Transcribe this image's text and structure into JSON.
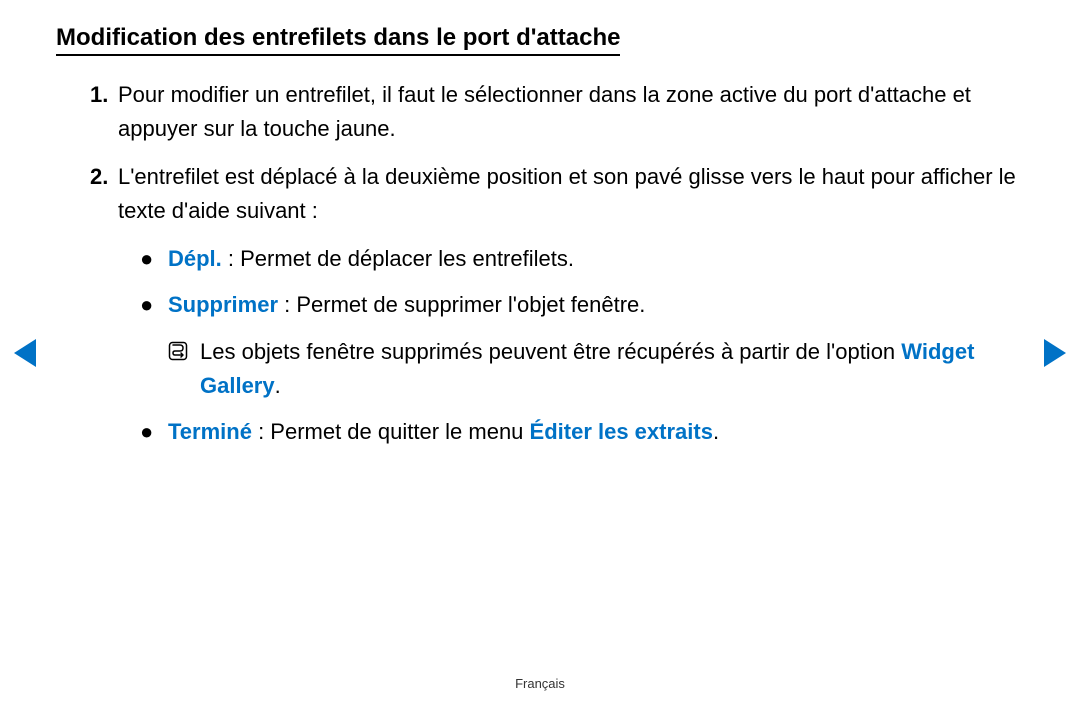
{
  "title": "Modification des entrefilets dans le port d'attache",
  "items": {
    "one": {
      "num": "1.",
      "text": "Pour modifier un entrefilet, il faut le sélectionner dans la zone active du port d'attache et appuyer sur la touche jaune."
    },
    "two": {
      "num": "2.",
      "text": "L'entrefilet est déplacé à la deuxième position et son pavé glisse vers le haut pour afficher le texte d'aide suivant :"
    }
  },
  "sub": {
    "depl_label": "Dépl.",
    "depl_rest": " : Permet de déplacer les entrefilets.",
    "suppr_label": "Supprimer",
    "suppr_rest": " : Permet de supprimer l'objet fenêtre.",
    "note_prefix": "Les objets fenêtre supprimés peuvent être récupérés à partir de l'option ",
    "note_gallery": "Widget Gallery",
    "note_suffix": ".",
    "termine_label": "Terminé",
    "termine_mid": " : Permet de quitter le menu ",
    "termine_menu": "Éditer les extraits",
    "termine_suffix": "."
  },
  "bullet": "●",
  "footer": "Français"
}
